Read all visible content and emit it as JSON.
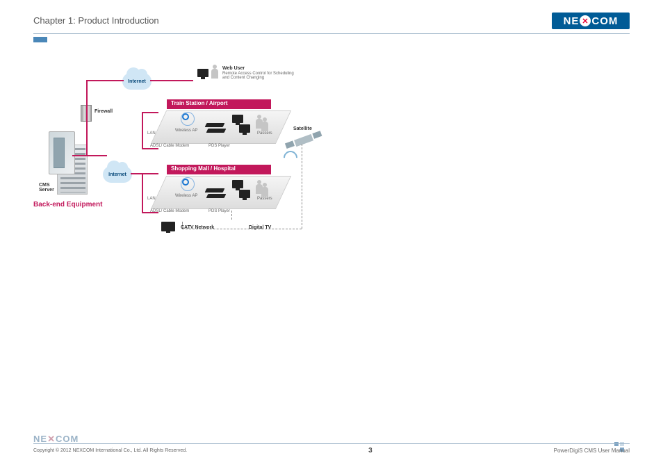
{
  "header": {
    "chapter": "Chapter 1: Product Introduction",
    "brand": "NEXCOM"
  },
  "diagram": {
    "backend_title": "Back-end Equipment",
    "cms_server": "CMS\nServer",
    "firewall": "Firewall",
    "internet": "Internet",
    "web_user_title": "Web User",
    "web_user_desc": "Remote Access Control for Scheduling and Content Changing",
    "zone1": {
      "band": "Train Station / Airport",
      "lan": "LAN",
      "wireless_ap": "Wireless AP",
      "modem": "ADSL/ Cable Modem",
      "player": "PDS Player",
      "passers": "Passers"
    },
    "zone2": {
      "band": "Shopping Mall / Hospital",
      "lan": "LAN",
      "wireless_ap": "Wireless AP",
      "modem": "ADSL/ Cable Modem",
      "player": "PDS Player",
      "passers": "Passers"
    },
    "satellite": "Satellite",
    "catv": "CATV Network",
    "digital_tv": "Digital TV"
  },
  "footer": {
    "brand": "NEXCOM",
    "copyright": "Copyright © 2012 NEXCOM International Co., Ltd. All Rights Reserved.",
    "page": "3",
    "doc": "PowerDigiS CMS User Manual"
  }
}
